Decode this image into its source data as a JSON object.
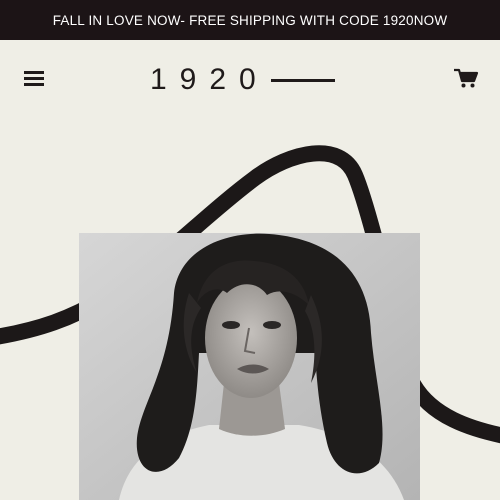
{
  "announcement": {
    "text": "FALL IN LOVE NOW- FREE SHIPPING WITH CODE 1920NOW"
  },
  "header": {
    "menu_icon": "hamburger-menu-icon",
    "logo_text": "1920",
    "cart_icon": "shopping-cart-icon"
  },
  "hero": {
    "image_subject": "black-and-white portrait of a woman with curly hair",
    "swoosh_color": "#1c1818"
  },
  "colors": {
    "background": "#efeee6",
    "announcement_bar": "#1c1416",
    "text_dark": "#1f1a1a"
  }
}
